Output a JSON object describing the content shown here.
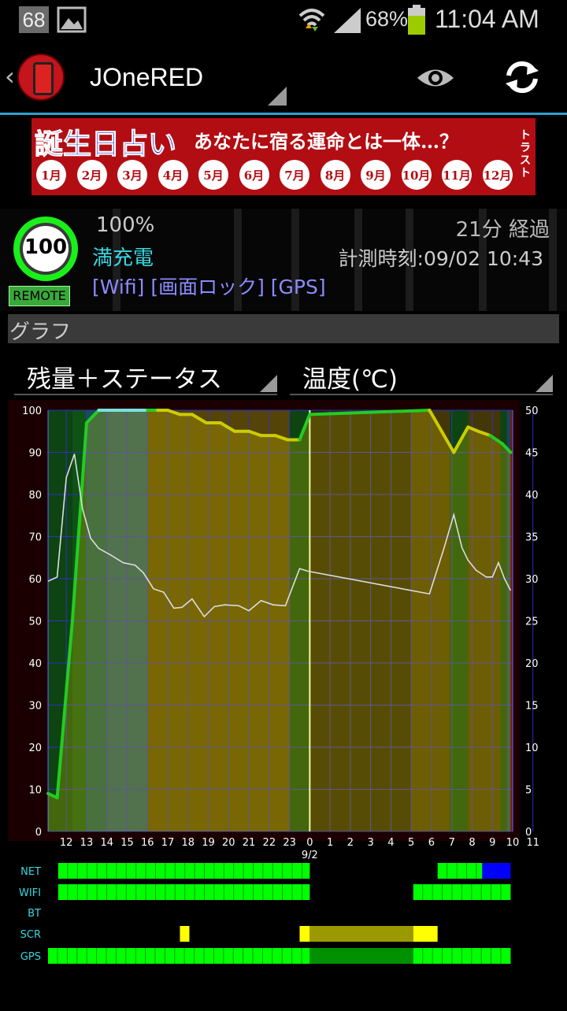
{
  "status_bar": {
    "notification_badge": "68",
    "battery_percent": "68%",
    "time": "11:04 AM",
    "icons": [
      "notification-68-icon",
      "picture-icon",
      "wifi-icon",
      "signal-icon",
      "battery-icon"
    ]
  },
  "action_bar": {
    "title": "JOneRED",
    "icons": [
      "back-chevron-icon",
      "phone-app-icon",
      "eye-icon",
      "refresh-icon"
    ]
  },
  "banner": {
    "title": "誕生日占い",
    "subtitle": "あなたに宿る運命とは一体…？",
    "side_text": "トラスト",
    "months": [
      "1月",
      "2月",
      "3月",
      "4月",
      "5月",
      "6月",
      "7月",
      "8月",
      "9月",
      "10月",
      "11月",
      "12月"
    ]
  },
  "device": {
    "battery_level": "100",
    "percent_text": "100%",
    "charge_status": "満充電",
    "remote_label": "REMOTE",
    "elapsed": "21分 経過",
    "measured_time": "計測時刻:09/02 10:43",
    "flags": "[Wifi] [画面ロック] [GPS]"
  },
  "section": {
    "title": "グラフ"
  },
  "spinners": {
    "left": "残量＋ステータス",
    "right": "温度(℃)"
  },
  "colors": {
    "battery_green": "#22cc22",
    "battery_yellow": "#cccc00",
    "temp_line": "#dddddd",
    "net_green": "#00ff00",
    "net_blue": "#0000ff",
    "scr_yellow": "#ffff00",
    "accent": "#2f9fd0"
  },
  "chart_data": {
    "type": "line",
    "x_tick_labels": [
      "12",
      "13",
      "14",
      "15",
      "16",
      "17",
      "18",
      "19",
      "20",
      "21",
      "22",
      "23",
      "0",
      "1",
      "2",
      "3",
      "4",
      "5",
      "6",
      "7",
      "8",
      "9",
      "10",
      "11"
    ],
    "date_marker": "9/2",
    "y_left_ticks": [
      "0",
      "10",
      "20",
      "30",
      "40",
      "50",
      "60",
      "70",
      "80",
      "90",
      "100"
    ],
    "y_right_ticks": [
      "0",
      "5",
      "10",
      "15",
      "20",
      "25",
      "30",
      "35",
      "40",
      "45",
      "50"
    ],
    "ylim_left": [
      0,
      100
    ],
    "ylim_right": [
      0,
      50
    ],
    "xlim_hours": [
      11.1,
      34.0
    ],
    "series": [
      {
        "x": [
          11.1,
          11.55,
          12.3,
          13.0,
          13.6,
          14.0,
          16.0,
          16.5,
          17.0,
          17.6,
          18.2,
          18.9,
          19.6,
          20.3,
          21.0,
          21.6,
          22.3,
          22.9,
          23.5,
          24.0,
          29.9,
          30.5,
          31.1,
          31.8,
          32.3,
          32.9,
          33.5,
          33.9
        ],
        "values": [
          9,
          8,
          50,
          97,
          100,
          100,
          100,
          100,
          100,
          99,
          99,
          97,
          97,
          95,
          95,
          94,
          94,
          93,
          93,
          99,
          100,
          95,
          90,
          96,
          95,
          94,
          92,
          90
        ],
        "values_tail": [
          90,
          97,
          100
        ]
      },
      {
        "x": [
          11.1,
          11.55,
          12.0,
          12.4,
          12.8,
          13.2,
          13.6,
          14.2,
          14.8,
          15.4,
          15.8,
          16.3,
          16.8,
          17.3,
          17.7,
          18.2,
          18.8,
          19.3,
          19.8,
          20.5,
          21.0,
          21.6,
          22.2,
          22.8,
          23.5,
          23.9,
          29.9,
          30.6,
          31.1,
          31.5,
          31.8,
          32.2,
          32.7,
          33.0,
          33.3,
          33.6,
          33.9
        ],
        "values": [
          29.7,
          30.2,
          42,
          44.8,
          38.3,
          34.8,
          33.6,
          32.8,
          31.9,
          31.6,
          30.7,
          28.8,
          28.4,
          26.5,
          26.6,
          27.6,
          25.5,
          26.7,
          26.9,
          26.8,
          26.2,
          27.4,
          26.9,
          26.8,
          31.2,
          30.9,
          28.2,
          33.5,
          37.6,
          33.7,
          32.2,
          31.0,
          30.2,
          30.2,
          31.9,
          30.0,
          28.6
        ]
      }
    ],
    "status_rows": [
      "NET",
      "WIFI",
      "BT",
      "SCR",
      "GPS"
    ]
  }
}
